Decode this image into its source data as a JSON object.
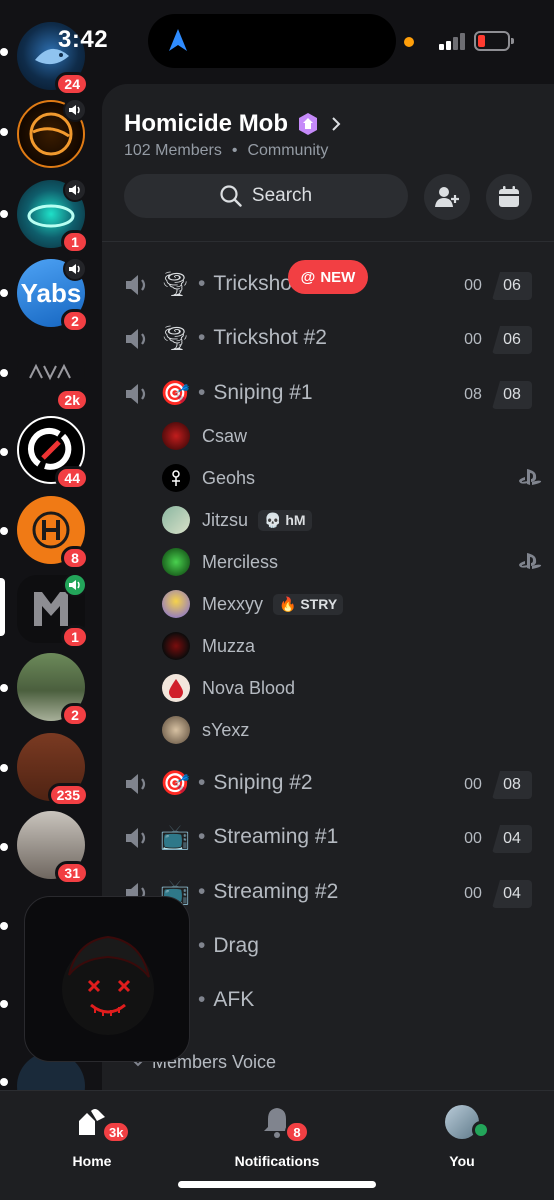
{
  "status_bar": {
    "time": "3:42"
  },
  "rail": {
    "servers": [
      {
        "badge": "24"
      },
      {
        "badge": ""
      },
      {
        "badge": "1"
      },
      {
        "label": "Yabs",
        "badge": "2"
      },
      {
        "badge": "2k"
      },
      {
        "badge": "44"
      },
      {
        "badge": "8"
      },
      {
        "badge": "1"
      },
      {
        "badge": "2"
      },
      {
        "badge": "235"
      },
      {
        "badge": "31"
      }
    ]
  },
  "server": {
    "name": "Homicide Mob",
    "members": "102 Members",
    "type": "Community",
    "search_label": "Search"
  },
  "new_pill": {
    "label": "NEW"
  },
  "channels": [
    {
      "emoji": "🌪",
      "name": "Trickshot #1",
      "count_a": "00",
      "count_b": "06"
    },
    {
      "emoji": "🌪",
      "name": "Trickshot #2",
      "count_a": "00",
      "count_b": "06"
    },
    {
      "emoji": "🎯",
      "name": "Sniping #1",
      "count_a": "08",
      "count_b": "08"
    },
    {
      "emoji": "🎯",
      "name": "Sniping #2",
      "count_a": "00",
      "count_b": "08"
    },
    {
      "emoji": "📺",
      "name": "Streaming #1",
      "count_a": "00",
      "count_b": "04"
    },
    {
      "emoji": "📺",
      "name": "Streaming #2",
      "count_a": "00",
      "count_b": "04"
    },
    {
      "emoji": "",
      "name": "Drag",
      "count_a": "",
      "count_b": ""
    },
    {
      "emoji": "",
      "name": "AFK",
      "count_a": "",
      "count_b": ""
    }
  ],
  "members": [
    {
      "name": "Csaw",
      "tag": "",
      "ps": false
    },
    {
      "name": "Geohs",
      "tag": "",
      "ps": true
    },
    {
      "name": "Jitzsu",
      "tag": "💀 hM",
      "ps": false
    },
    {
      "name": "Merciless",
      "tag": "",
      "ps": true
    },
    {
      "name": "Mexxyy",
      "tag": "🔥 STRY",
      "ps": false
    },
    {
      "name": "Muzza",
      "tag": "",
      "ps": false
    },
    {
      "name": "Nova Blood",
      "tag": "",
      "ps": false
    },
    {
      "name": "sYexz",
      "tag": "",
      "ps": false
    }
  ],
  "category": {
    "label": "Members Voice"
  },
  "tabbar": {
    "home": {
      "label": "Home",
      "badge": "3k"
    },
    "notifications": {
      "label": "Notifications",
      "badge": "8"
    },
    "you": {
      "label": "You"
    }
  },
  "colors": {
    "danger": "#f23f43",
    "online": "#23a55a",
    "panel": "#1e1f22",
    "rail": "#121215"
  }
}
